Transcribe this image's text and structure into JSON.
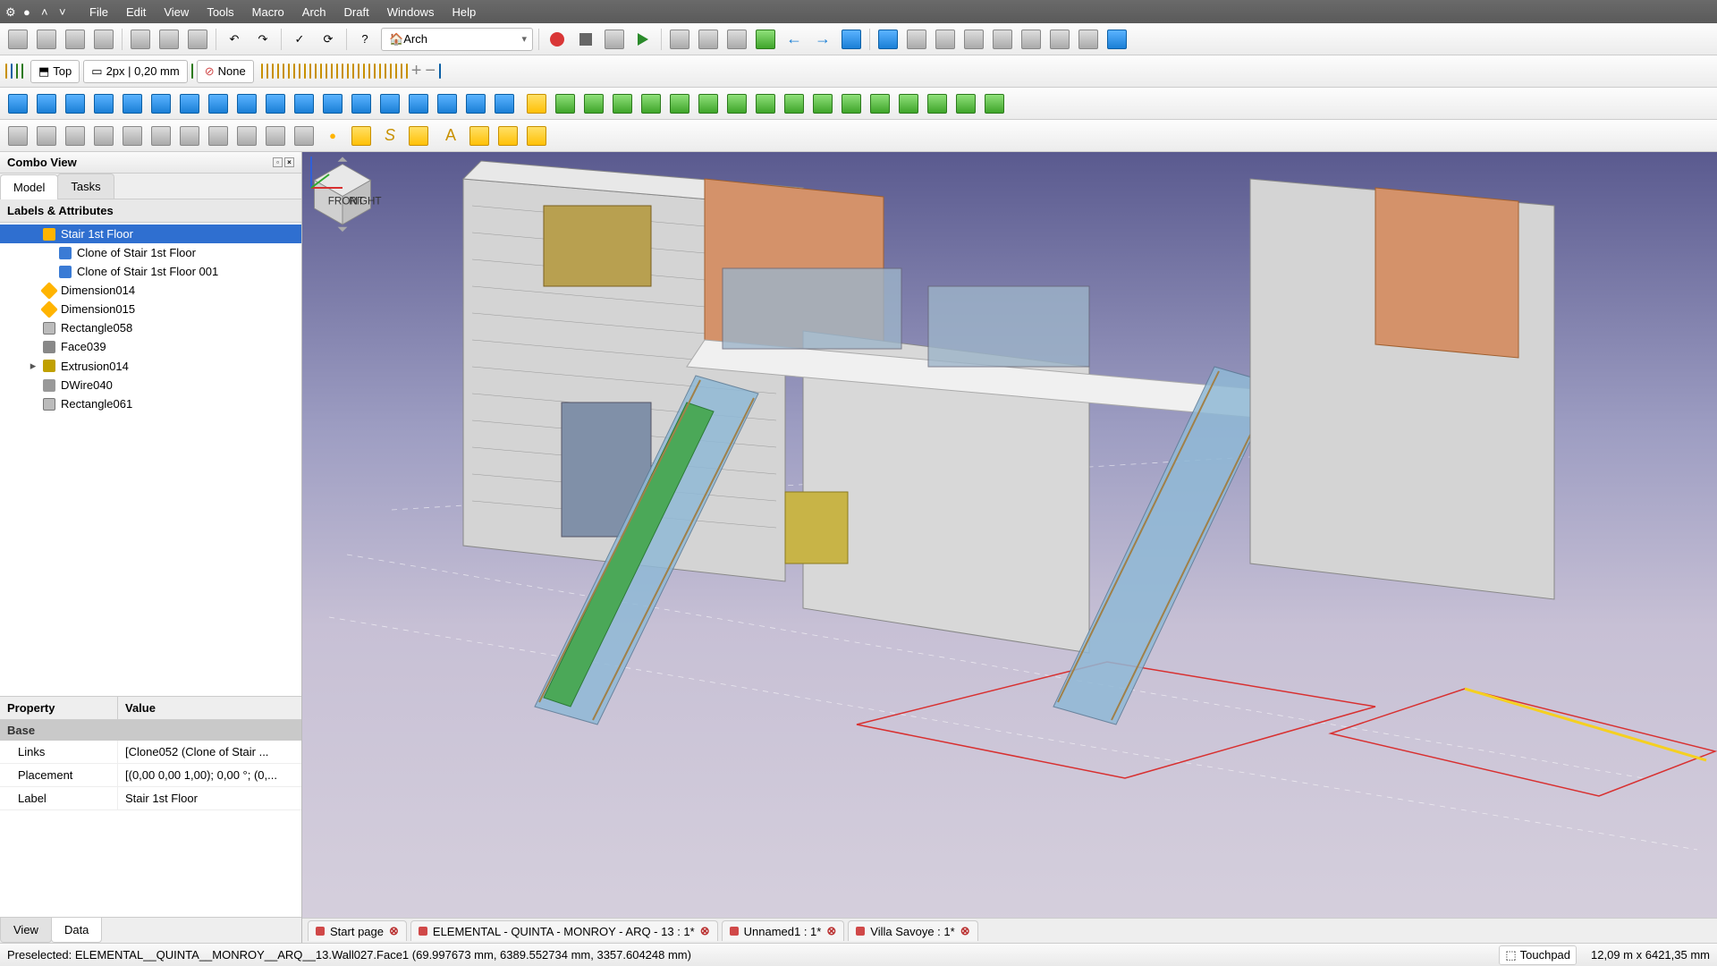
{
  "menu": {
    "items": [
      "File",
      "Edit",
      "View",
      "Tools",
      "Macro",
      "Arch",
      "Draft",
      "Windows",
      "Help"
    ]
  },
  "workbench": {
    "selected": "Arch"
  },
  "style": {
    "view_label": "Top",
    "line_label": "2px | 0,20 mm",
    "fill_label": "None"
  },
  "combo": {
    "title": "Combo View",
    "tabs": [
      "Model",
      "Tasks"
    ],
    "active_tab": 0,
    "header": "Labels & Attributes",
    "tree": [
      {
        "label": "Stair 1st Floor",
        "icon": "stair",
        "selected": true,
        "indent": 1
      },
      {
        "label": "Clone of Stair 1st Floor",
        "icon": "clone",
        "indent": 2
      },
      {
        "label": "Clone of Stair 1st Floor 001",
        "icon": "clone",
        "indent": 2
      },
      {
        "label": "Dimension014",
        "icon": "dim",
        "indent": 1
      },
      {
        "label": "Dimension015",
        "icon": "dim",
        "indent": 1
      },
      {
        "label": "Rectangle058",
        "icon": "rect",
        "indent": 1
      },
      {
        "label": "Face039",
        "icon": "face",
        "indent": 1
      },
      {
        "label": "Extrusion014",
        "icon": "ext",
        "indent": 1,
        "expandable": true
      },
      {
        "label": "DWire040",
        "icon": "wire",
        "indent": 1
      },
      {
        "label": "Rectangle061",
        "icon": "rect",
        "indent": 1
      }
    ],
    "prop_cols": [
      "Property",
      "Value"
    ],
    "prop_group": "Base",
    "props": [
      {
        "name": "Links",
        "value": "[Clone052 (Clone of Stair ..."
      },
      {
        "name": "Placement",
        "value": "[(0,00 0,00 1,00); 0,00 °; (0,..."
      },
      {
        "name": "Label",
        "value": "Stair 1st Floor"
      }
    ],
    "bottom_tabs": [
      "View",
      "Data"
    ],
    "bottom_active": 1
  },
  "doc_tabs": [
    {
      "label": "Start page",
      "close": true
    },
    {
      "label": "ELEMENTAL - QUINTA - MONROY - ARQ - 13 : 1*",
      "close": true
    },
    {
      "label": "Unnamed1 : 1*",
      "close": true
    },
    {
      "label": "Villa Savoye : 1*",
      "close": true
    }
  ],
  "status": {
    "preselect": "Preselected: ELEMENTAL__QUINTA__MONROY__ARQ__13.Wall027.Face1 (69.997673 mm, 6389.552734 mm, 3357.604248 mm)",
    "navmode": "Touchpad",
    "dims": "12,09 m x 6421,35 mm"
  },
  "navcube": {
    "front": "FRONT",
    "right": "RIGHT"
  }
}
